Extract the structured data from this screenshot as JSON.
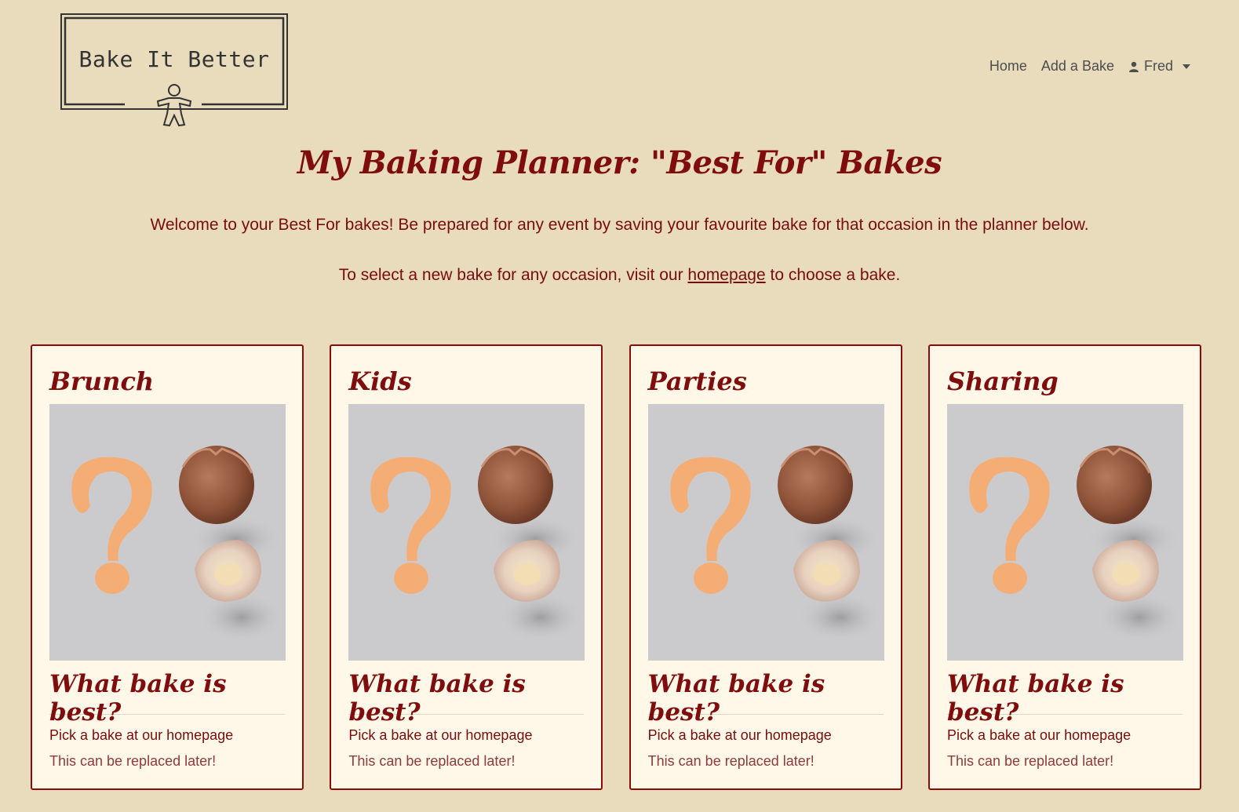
{
  "logo": {
    "text": "Bake It Better"
  },
  "nav": {
    "home": "Home",
    "add_bake": "Add a Bake",
    "user": "Fred"
  },
  "page": {
    "title": "My Baking Planner: \"Best For\" Bakes",
    "intro": "Welcome to your Best For bakes! Be prepared for any event by saving your favourite bake for that occasion in the planner below.",
    "select_prefix": "To select a new bake for any occasion, visit our ",
    "select_link": "homepage",
    "select_suffix": " to choose a bake."
  },
  "cards": [
    {
      "title": "Brunch",
      "subtitle": "What bake is best?",
      "line1": "Pick a bake at our homepage",
      "line2": "This can be replaced later!"
    },
    {
      "title": "Kids",
      "subtitle": "What bake is best?",
      "line1": "Pick a bake at our homepage",
      "line2": "This can be replaced later!"
    },
    {
      "title": "Parties",
      "subtitle": "What bake is best?",
      "line1": "Pick a bake at our homepage",
      "line2": "This can be replaced later!"
    },
    {
      "title": "Sharing",
      "subtitle": "What bake is best?",
      "line1": "Pick a bake at our homepage",
      "line2": "This can be replaced later!"
    }
  ],
  "colors": {
    "background": "#e8dcbd",
    "accent": "#800d0d",
    "card_bg": "#fff8e8",
    "question_mark": "#f5ad76"
  }
}
